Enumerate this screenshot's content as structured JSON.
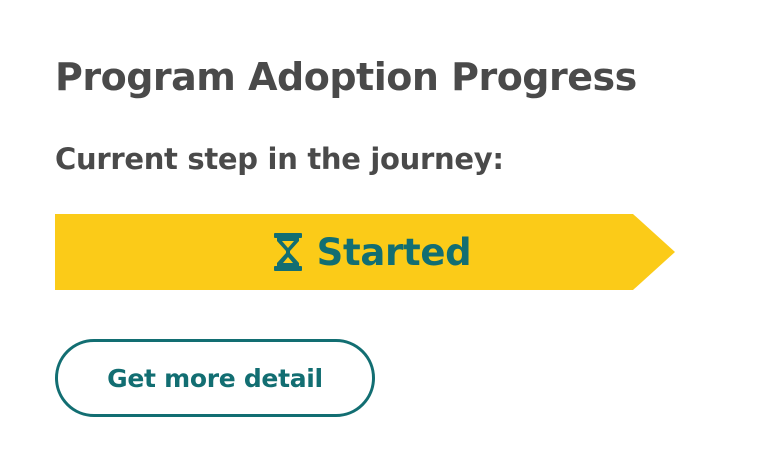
{
  "card": {
    "title": "Program Adoption Progress",
    "subtitle": "Current step in the journey:"
  },
  "step": {
    "label": "Started",
    "icon": "hourglass-icon",
    "banner_color": "#fbcb18",
    "text_color": "#126e72"
  },
  "actions": {
    "detail_label": "Get more detail",
    "accent_color": "#126e72"
  }
}
